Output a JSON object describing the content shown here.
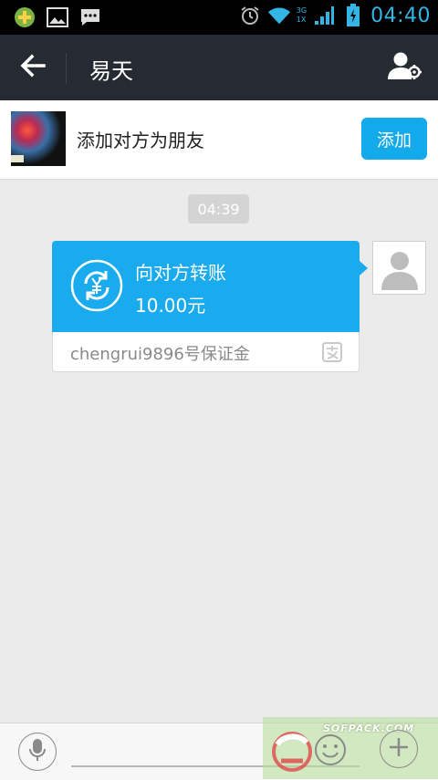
{
  "status_bar": {
    "time": "04:40",
    "network_labels": [
      "3G",
      "1X"
    ],
    "icons": [
      "app-icon",
      "image-icon",
      "message-icon",
      "alarm-icon",
      "wifi-icon",
      "signal-icon",
      "battery-icon"
    ],
    "clock_color": "#33b5e5"
  },
  "header": {
    "title": "易天",
    "back_icon": "arrow-left-icon",
    "contact_icon": "contact-settings-icon"
  },
  "banner": {
    "text": "添加对方为朋友",
    "button_label": "添加"
  },
  "chat": {
    "timestamp": "04:39",
    "transfer": {
      "title": "向对方转账",
      "amount": "10.00元",
      "note": "chengrui9896号保证金",
      "icon": "transfer-yen-icon",
      "accent": "#1aabee"
    }
  },
  "bottom_bar": {
    "voice_icon": "microphone-icon",
    "emoji_icon": "emoji-icon",
    "plus_icon": "plus-icon"
  },
  "watermark": {
    "text": "SOFPACK.COM"
  }
}
